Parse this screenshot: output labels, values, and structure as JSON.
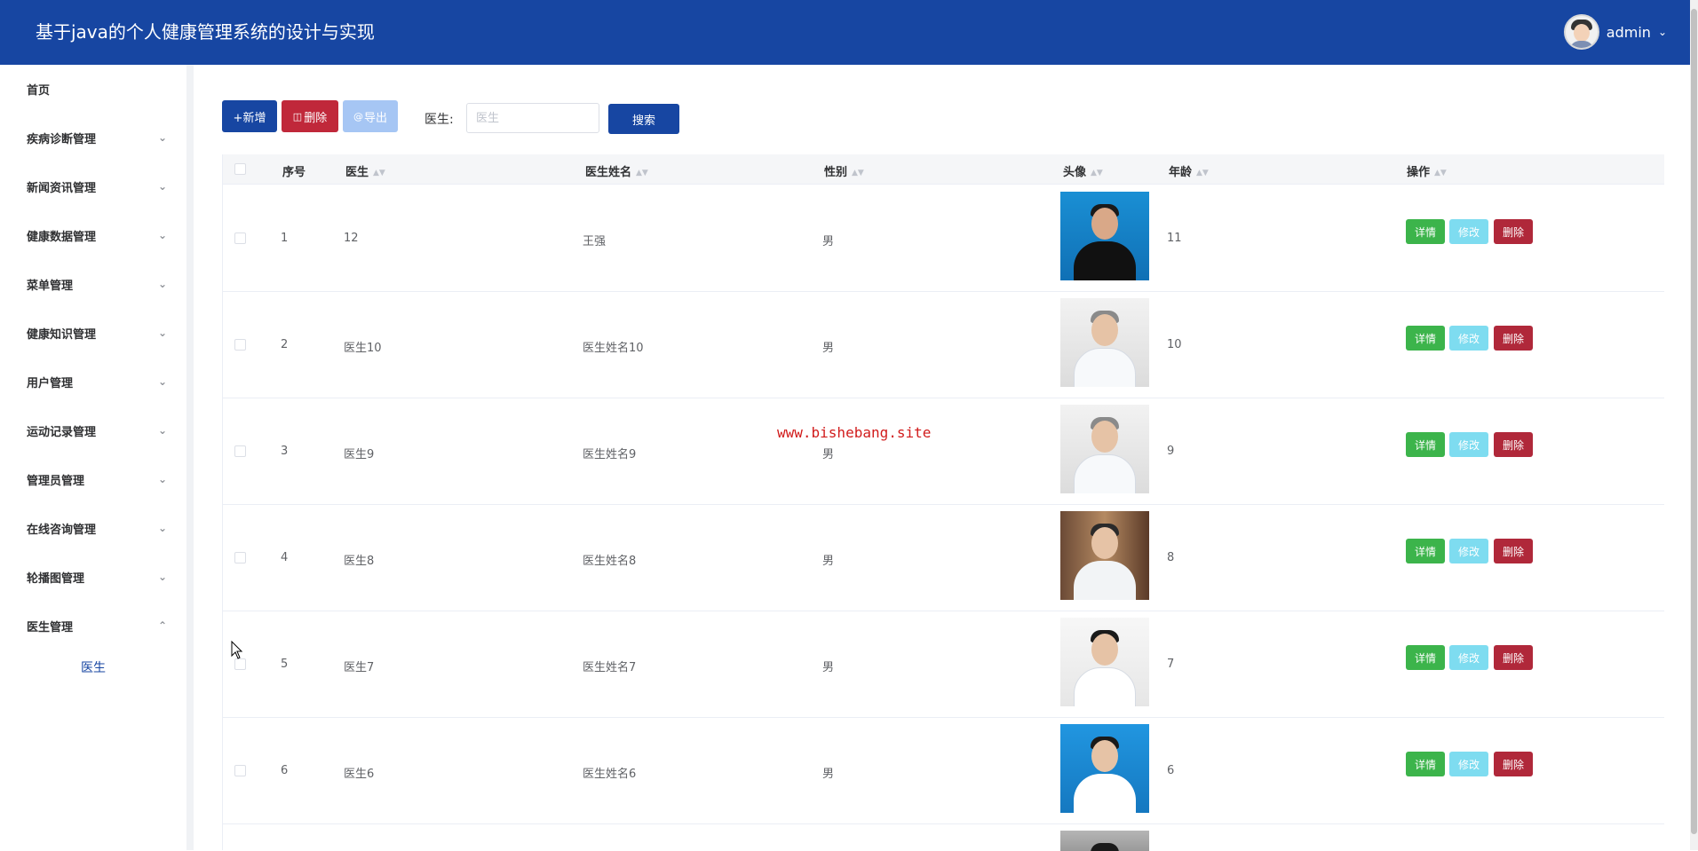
{
  "header": {
    "title": "基于java的个人健康管理系统的设计与实现",
    "username": "admin"
  },
  "sidebar": {
    "items": [
      {
        "label": "首页"
      },
      {
        "label": "疾病诊断管理"
      },
      {
        "label": "新闻资讯管理"
      },
      {
        "label": "健康数据管理"
      },
      {
        "label": "菜单管理"
      },
      {
        "label": "健康知识管理"
      },
      {
        "label": "用户管理"
      },
      {
        "label": "运动记录管理"
      },
      {
        "label": "管理员管理"
      },
      {
        "label": "在线咨询管理"
      },
      {
        "label": "轮播图管理"
      },
      {
        "label": "医生管理"
      }
    ],
    "sub_item": "医生"
  },
  "toolbar": {
    "add_label": "+新增",
    "delete_label": "删除",
    "export_label": "导出",
    "search_label": "医生:",
    "search_placeholder": "医生",
    "search_button": "搜索"
  },
  "table": {
    "columns": [
      "序号",
      "医生",
      "医生姓名",
      "性别",
      "头像",
      "年龄",
      "操作"
    ],
    "rows": [
      {
        "index": "1",
        "doctor": "12",
        "name": "王强",
        "gender": "男",
        "age": "11"
      },
      {
        "index": "2",
        "doctor": "医生10",
        "name": "医生姓名10",
        "gender": "男",
        "age": "10"
      },
      {
        "index": "3",
        "doctor": "医生9",
        "name": "医生姓名9",
        "gender": "男",
        "age": "9"
      },
      {
        "index": "4",
        "doctor": "医生8",
        "name": "医生姓名8",
        "gender": "男",
        "age": "8"
      },
      {
        "index": "5",
        "doctor": "医生7",
        "name": "医生姓名7",
        "gender": "男",
        "age": "7"
      },
      {
        "index": "6",
        "doctor": "医生6",
        "name": "医生姓名6",
        "gender": "男",
        "age": "6"
      }
    ],
    "actions": {
      "detail": "详情",
      "edit": "修改",
      "delete": "删除"
    }
  },
  "watermark": "www.bishebang.site",
  "colors": {
    "header_bg": "#1746a2",
    "primary": "#1746a2",
    "danger": "#c0283a",
    "success": "#3cb44b",
    "info": "#7edcf0"
  }
}
